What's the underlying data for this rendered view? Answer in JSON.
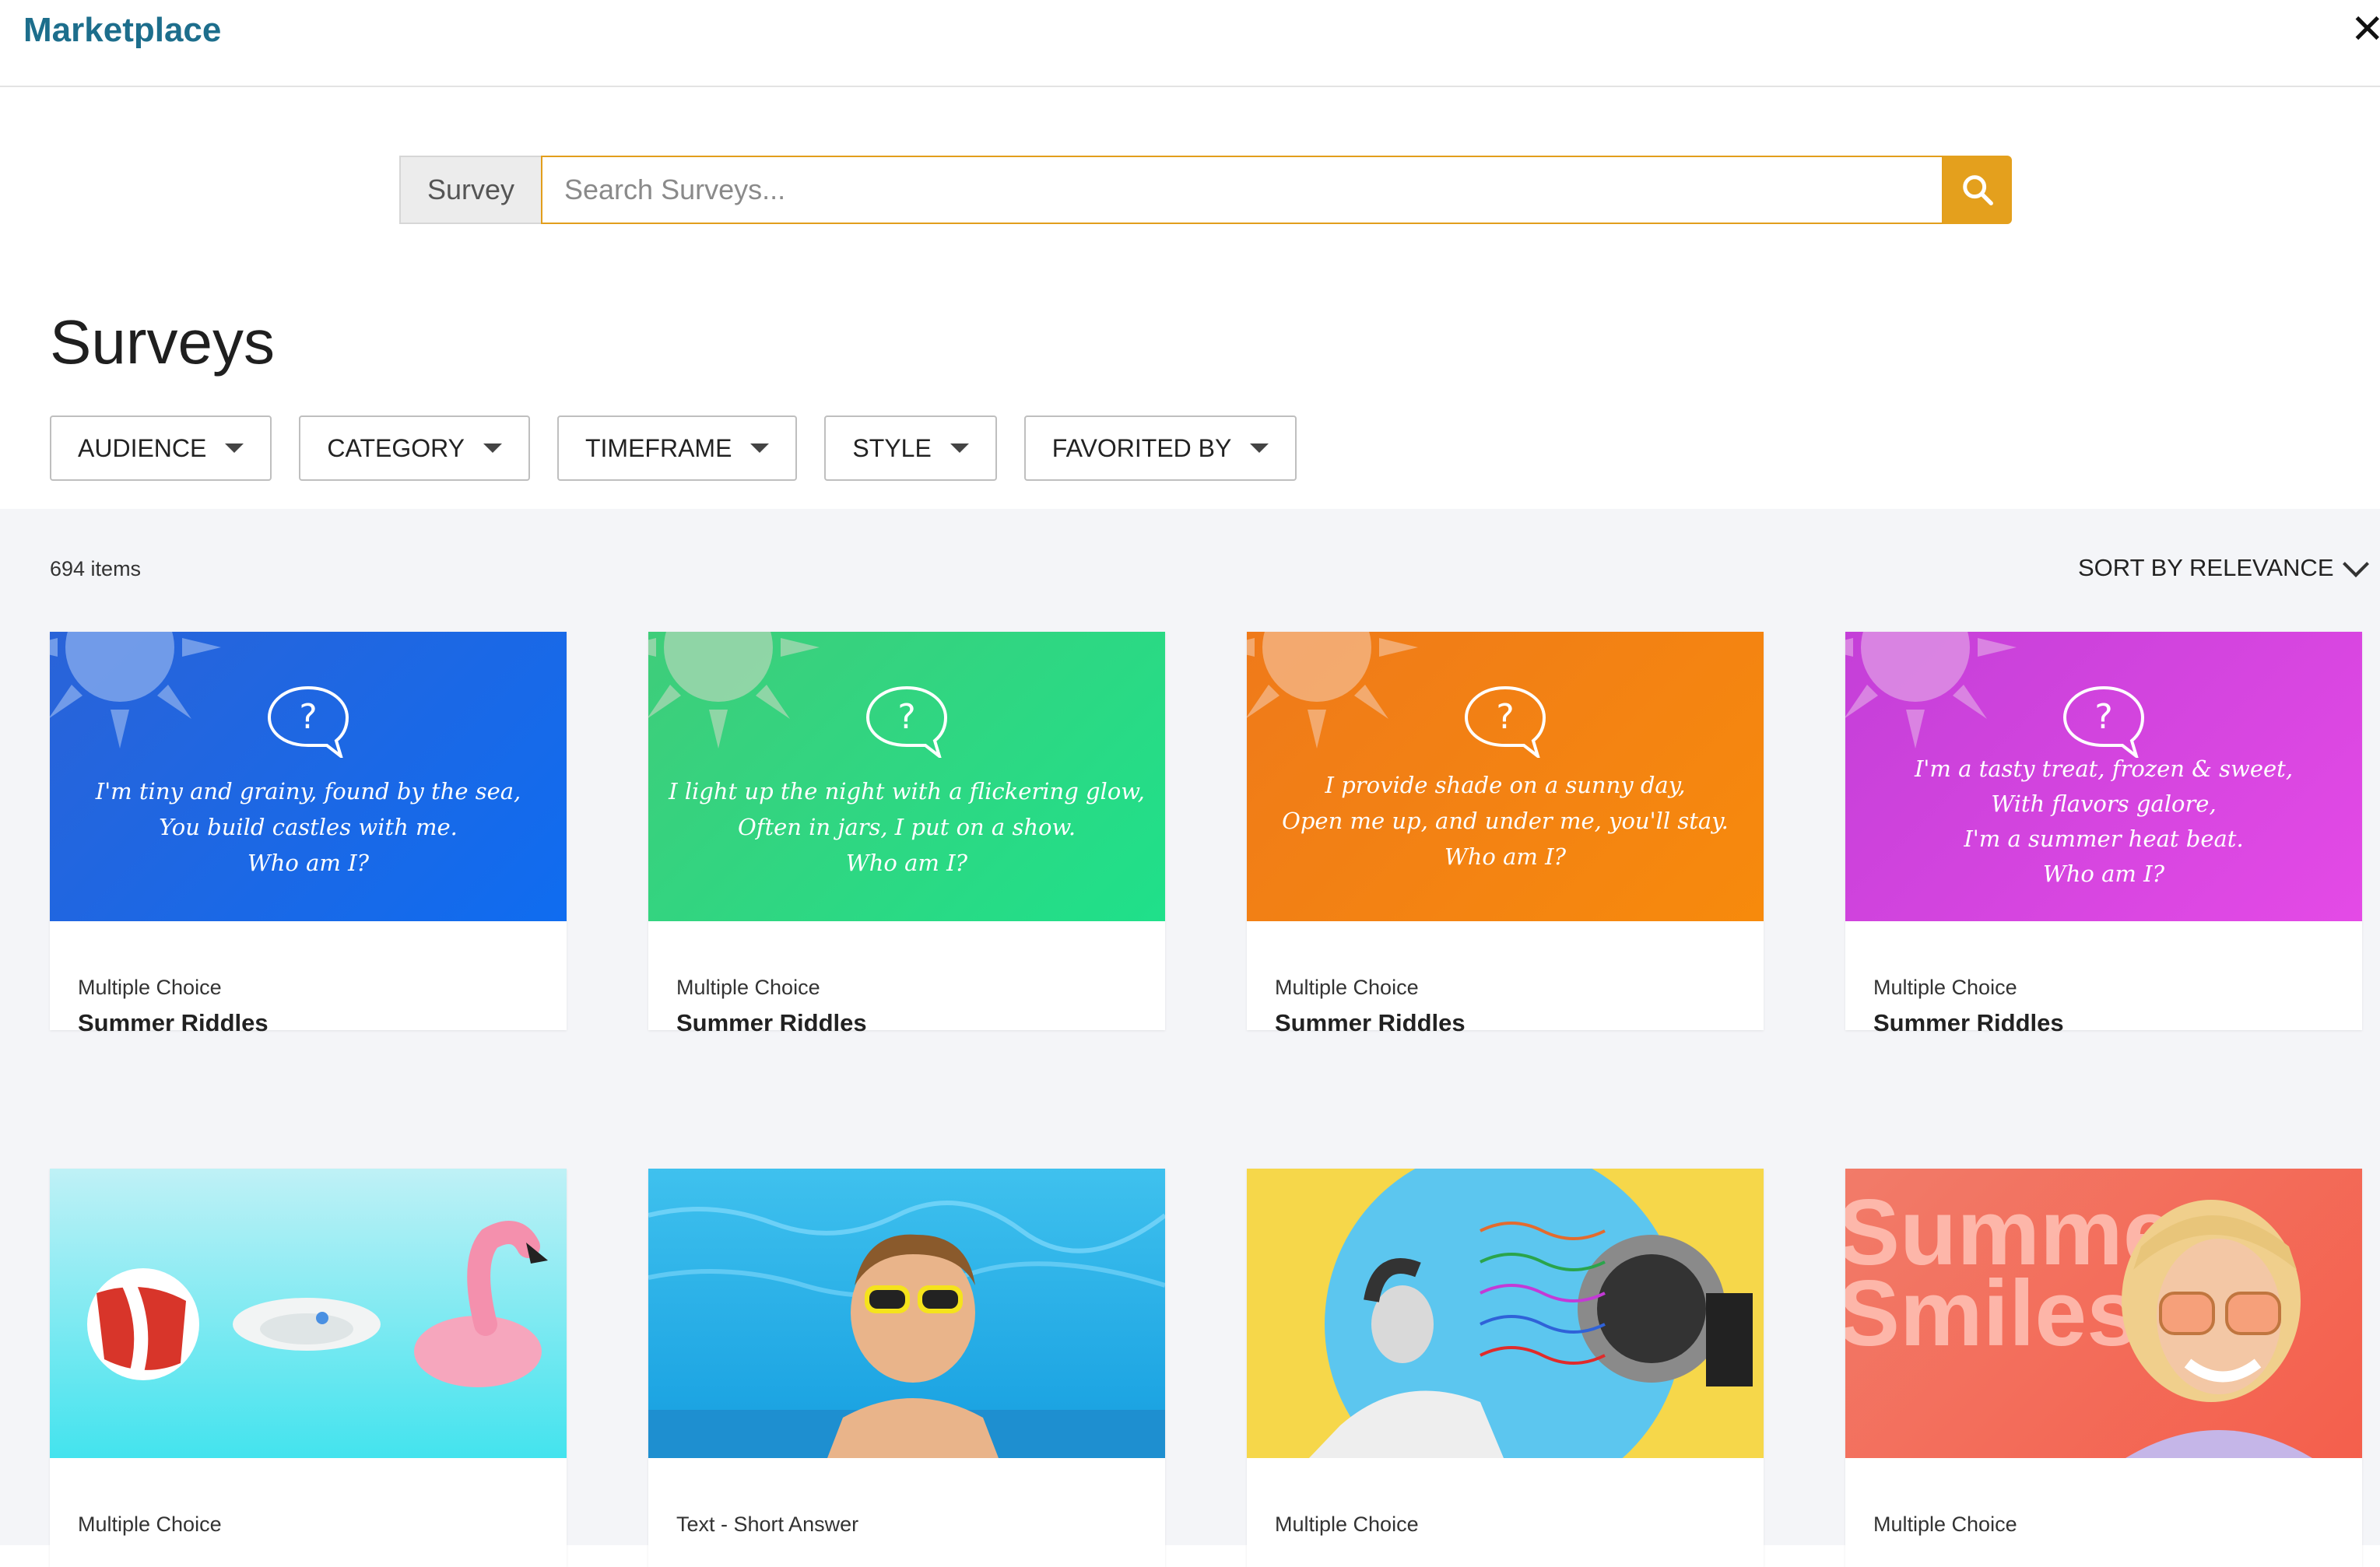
{
  "header": {
    "title": "Marketplace",
    "close_icon": "close-icon"
  },
  "search": {
    "type_label": "Survey",
    "placeholder": "Search Surveys...",
    "value": "",
    "button_icon": "search-icon",
    "accent": "#e4a01d"
  },
  "page_title": "Surveys",
  "filters": [
    {
      "label": "AUDIENCE"
    },
    {
      "label": "CATEGORY"
    },
    {
      "label": "TIMEFRAME"
    },
    {
      "label": "STYLE"
    },
    {
      "label": "FAVORITED BY"
    }
  ],
  "results": {
    "count": "694 items",
    "sort_label": "SORT BY RELEVANCE",
    "cards": [
      {
        "type": "Multiple Choice",
        "title": "Summer Riddles",
        "thumb_lines": [
          "I'm tiny and grainy, found by the sea,",
          "You build castles with me.",
          "Who am I?"
        ]
      },
      {
        "type": "Multiple Choice",
        "title": "Summer Riddles",
        "thumb_lines": [
          "I light up the night with a flickering glow,",
          "Often in jars, I put on a show.",
          "Who am I?"
        ]
      },
      {
        "type": "Multiple Choice",
        "title": "Summer Riddles",
        "thumb_lines": [
          "I provide shade on a sunny day,",
          "Open me up, and under me, you'll stay.",
          "Who am I?"
        ]
      },
      {
        "type": "Multiple Choice",
        "title": "Summer Riddles",
        "thumb_lines": [
          "I'm a tasty treat, frozen & sweet,",
          "With flavors galore,",
          "I'm a summer heat beat.",
          "Who am I?"
        ]
      },
      {
        "type": "Multiple Choice",
        "title": "",
        "thumb_desc": "beach-toys-image"
      },
      {
        "type": "Text - Short Answer",
        "title": "",
        "thumb_desc": "child-in-pool-image"
      },
      {
        "type": "Multiple Choice",
        "title": "",
        "thumb_desc": "woman-with-fan-image"
      },
      {
        "type": "Multiple Choice",
        "title": "",
        "thumb_desc": "summer-smiles-image",
        "thumb_text": "Summer Smiles"
      }
    ]
  },
  "colors": {
    "title": "#1d6e8c",
    "card1": "#1867e8",
    "card2": "#27d67c",
    "card3": "#f3780f",
    "card4": "#d640d8"
  }
}
